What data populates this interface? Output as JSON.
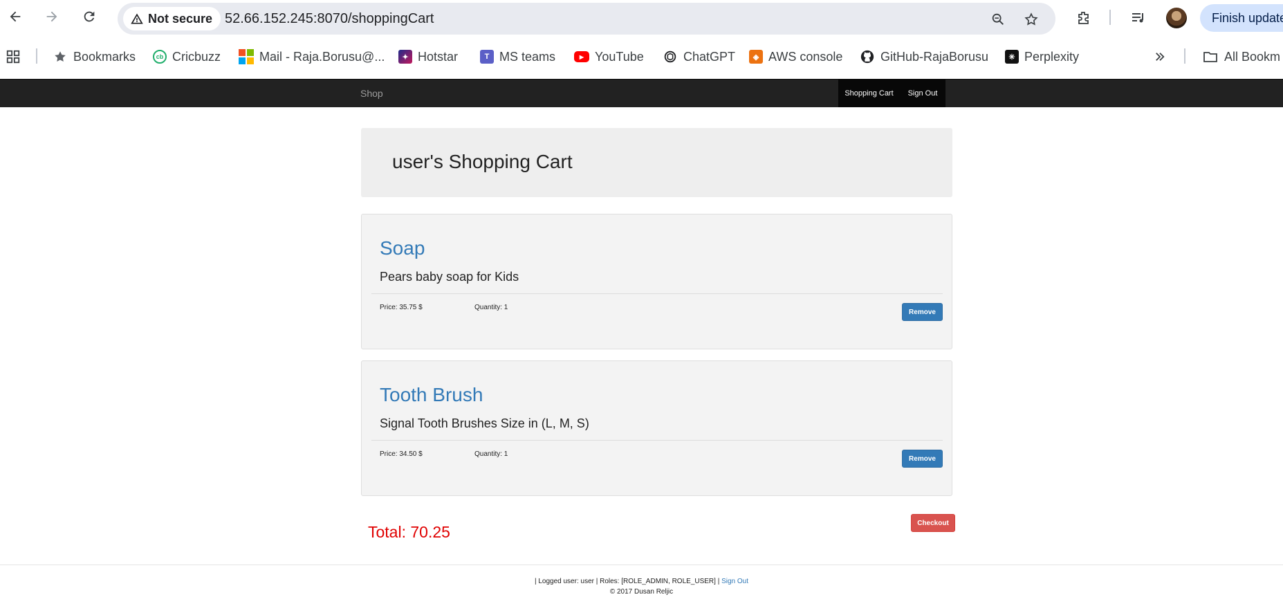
{
  "browser": {
    "security_label": "Not secure",
    "url": "52.66.152.245:8070/shoppingCart",
    "update_label": "Finish update",
    "bookmarks": [
      {
        "label": "Bookmarks",
        "icon": "star-icon"
      },
      {
        "label": "Cricbuzz",
        "icon": "cricbuzz-icon"
      },
      {
        "label": "Mail - Raja.Borusu@...",
        "icon": "microsoft-icon"
      },
      {
        "label": "Hotstar",
        "icon": "hotstar-icon"
      },
      {
        "label": "MS teams",
        "icon": "teams-icon"
      },
      {
        "label": "YouTube",
        "icon": "youtube-icon"
      },
      {
        "label": "ChatGPT",
        "icon": "chatgpt-icon"
      },
      {
        "label": "AWS console",
        "icon": "aws-icon"
      },
      {
        "label": "GitHub-RajaBorusu",
        "icon": "github-icon"
      },
      {
        "label": "Perplexity",
        "icon": "perplexity-icon"
      }
    ],
    "all_bookmarks_label": "All Bookm"
  },
  "navbar": {
    "brand": "Shop",
    "links": [
      "Shopping Cart",
      "Sign Out"
    ]
  },
  "cart": {
    "heading": "user's Shopping Cart",
    "items": [
      {
        "name": "Soap",
        "description": "Pears baby soap for Kids",
        "price": "Price: 35.75 $",
        "quantity": "Quantity: 1",
        "remove_label": "Remove"
      },
      {
        "name": "Tooth Brush",
        "description": "Signal Tooth Brushes Size in (L, M, S)",
        "price": "Price: 34.50 $",
        "quantity": "Quantity: 1",
        "remove_label": "Remove"
      }
    ],
    "total": "Total: 70.25",
    "checkout_label": "Checkout"
  },
  "footer": {
    "user_info": "| Logged user: user | Roles: [ROLE_ADMIN, ROLE_USER] |",
    "sign_out": "Sign Out",
    "copyright": "© 2017 Dusan Reljic"
  },
  "colors": {
    "link_blue": "#337ab7",
    "danger_red": "#d9534f",
    "navbar_dark": "#222222",
    "total_red": "#e00000"
  }
}
